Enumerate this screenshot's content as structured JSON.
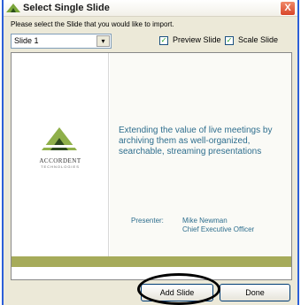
{
  "dialog": {
    "title": "Select Single Slide",
    "close_label": "X"
  },
  "instruction": "Please select the Slide that you would like to import.",
  "slide_select": {
    "value": "Slide 1",
    "arrow": "▾"
  },
  "checkboxes": [
    {
      "label": "Preview Slide",
      "checked": true
    },
    {
      "label": "Scale Slide",
      "checked": true
    }
  ],
  "slide": {
    "logo_name": "ACCORDENT",
    "logo_sub": "TECHNOLOGIES",
    "headline": "Extending the value of live meetings by archiving them as well-organized, searchable, streaming presentations",
    "presenter_label": "Presenter:",
    "presenter_name": "Mike Newman",
    "presenter_title": "Chief Executive Officer"
  },
  "buttons": {
    "add": "Add Slide",
    "done": "Done"
  },
  "colors": {
    "accent_green": "#a6ab5a",
    "text_blue": "#2e6e8e",
    "frame_blue": "#2c5fd8"
  }
}
